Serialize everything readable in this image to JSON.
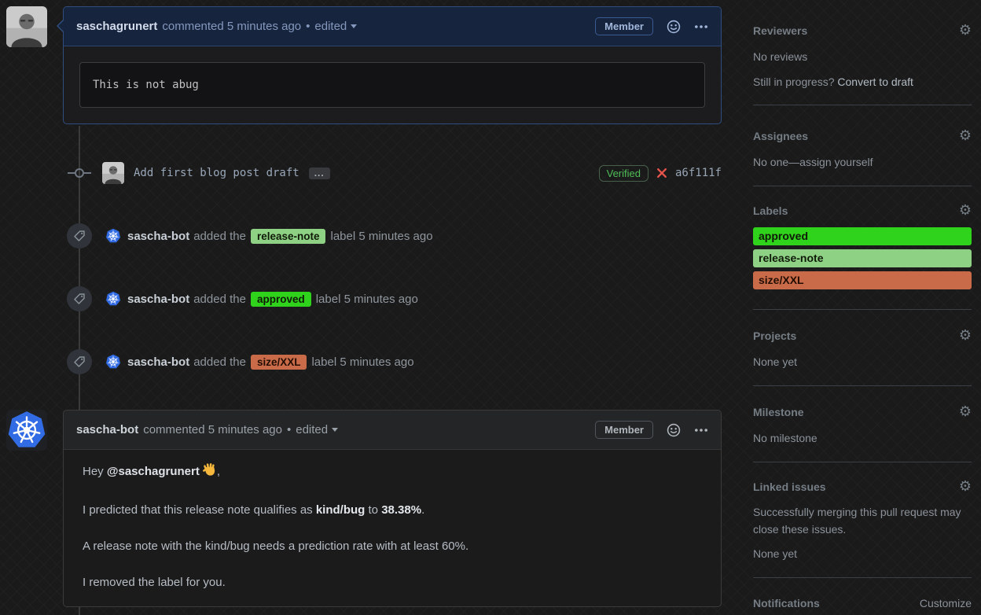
{
  "colors": {
    "highlight_border": "#2f4e7e",
    "k8s_blue": "#326ce5",
    "verified_green": "#4fbe58",
    "failed_red": "#e5534b",
    "label_approved_bg": "#2fd31c",
    "label_release_note_bg": "#8ed184",
    "label_size_xxl_bg": "#c96b49",
    "label_dark_text": "#101a08",
    "label_size_text": "#220d03"
  },
  "comment1": {
    "author": "saschagrunert",
    "action_time": "commented 5 minutes ago",
    "dot": "•",
    "edited": "edited",
    "member_badge": "Member",
    "body_code": "This is not abug"
  },
  "commit": {
    "message": "Add first blog post draft",
    "expander": "...",
    "verified_label": "Verified",
    "hash": "a6f111f"
  },
  "events": [
    {
      "author": "sascha-bot",
      "action": "added the",
      "label": "release-note",
      "suffix": "label 5 minutes ago",
      "label_bg": "#8ed184",
      "label_color": "#101a08"
    },
    {
      "author": "sascha-bot",
      "action": "added the",
      "label": "approved",
      "suffix": "label 5 minutes ago",
      "label_bg": "#2fd31c",
      "label_color": "#101a08"
    },
    {
      "author": "sascha-bot",
      "action": "added the",
      "label": "size/XXL",
      "suffix": "label 5 minutes ago",
      "label_bg": "#c96b49",
      "label_color": "#220d03"
    }
  ],
  "comment2": {
    "author": "sascha-bot",
    "action_time": "commented 5 minutes ago",
    "dot": "•",
    "edited": "edited",
    "member_badge": "Member",
    "p1_prefix": "Hey ",
    "p1_mention": "@saschagrunert",
    "p1_wave_icon": "waving-hand",
    "p1_suffix": ",",
    "p2_prefix": "I predicted that this release note qualifies as ",
    "p2_bold1": "kind/bug",
    "p2_mid": " to ",
    "p2_bold2": "38.38%",
    "p2_suffix": ".",
    "p3": "A release note with the kind/bug needs a prediction rate with at least 60%.",
    "p4": "I removed the label for you."
  },
  "sidebar": {
    "reviewers": {
      "title": "Reviewers",
      "empty": "No reviews",
      "hint_prefix": "Still in progress? ",
      "hint_link": "Convert to draft"
    },
    "assignees": {
      "title": "Assignees",
      "empty_prefix": "No one—",
      "empty_link": "assign yourself"
    },
    "labels": {
      "title": "Labels",
      "items": [
        {
          "name": "approved",
          "bg": "#2fd31c",
          "color": "#101a08"
        },
        {
          "name": "release-note",
          "bg": "#8ed184",
          "color": "#101a08"
        },
        {
          "name": "size/XXL",
          "bg": "#c96b49",
          "color": "#220d03"
        }
      ]
    },
    "projects": {
      "title": "Projects",
      "empty": "None yet"
    },
    "milestone": {
      "title": "Milestone",
      "empty": "No milestone"
    },
    "linked_issues": {
      "title": "Linked issues",
      "desc": "Successfully merging this pull request may close these issues.",
      "empty": "None yet"
    },
    "notifications": {
      "title": "Notifications",
      "customize": "Customize"
    }
  }
}
